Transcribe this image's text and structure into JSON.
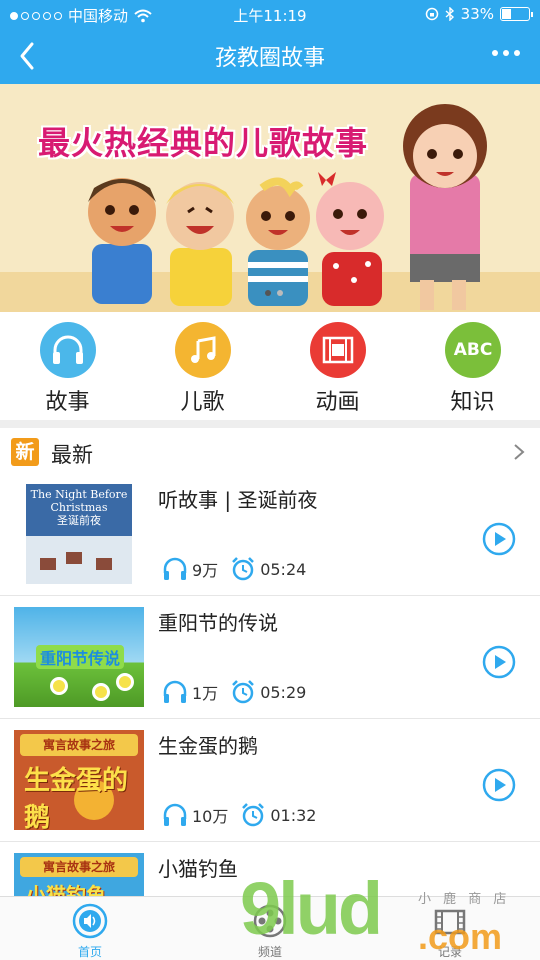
{
  "status": {
    "carrier": "中国移动",
    "time": "上午11:19",
    "battery": "33%",
    "battery_level": 0.33
  },
  "nav": {
    "title": "孩教圈故事"
  },
  "banner": {
    "slogan": "最火热经典的儿歌故事"
  },
  "categories": [
    {
      "label": "故事",
      "icon": "headphones-icon",
      "color": "#4bb7ea"
    },
    {
      "label": "儿歌",
      "icon": "music-note-icon",
      "color": "#f4b531"
    },
    {
      "label": "动画",
      "icon": "film-icon",
      "color": "#ea3b35"
    },
    {
      "label": "知识",
      "icon": "abc-icon",
      "color": "#7bbf3a"
    }
  ],
  "section": {
    "badge": "新",
    "title": "最新"
  },
  "items": [
    {
      "title": "听故事 | 圣诞前夜",
      "plays": "9万",
      "duration": "05:24",
      "thumb_text": "The Night Before Christmas",
      "thumb_subtext": "圣诞前夜"
    },
    {
      "title": "重阳节的传说",
      "plays": "1万",
      "duration": "05:29",
      "thumb_text": "重阳节传说"
    },
    {
      "title": "生金蛋的鹅",
      "plays": "10万",
      "duration": "01:32",
      "thumb_banner": "寓言故事之旅",
      "thumb_text": "生金蛋的鹅"
    },
    {
      "title": "小猫钓鱼",
      "plays": "",
      "duration": "",
      "thumb_banner": "寓言故事之旅",
      "thumb_text": "小猫钓鱼"
    }
  ],
  "tabs": [
    {
      "label": "首页",
      "icon": "volume-icon",
      "active": true
    },
    {
      "label": "频道",
      "icon": "film-reel-icon",
      "active": false
    },
    {
      "label": "记录",
      "icon": "clapperboard-icon",
      "active": false
    }
  ],
  "watermark": {
    "brand": "9lud",
    "tld": ".com",
    "sub": "小 鹿 商 店"
  },
  "colors": {
    "accent": "#2fa9ee",
    "badge": "#f29b1a",
    "play": "#2fa9ee"
  }
}
